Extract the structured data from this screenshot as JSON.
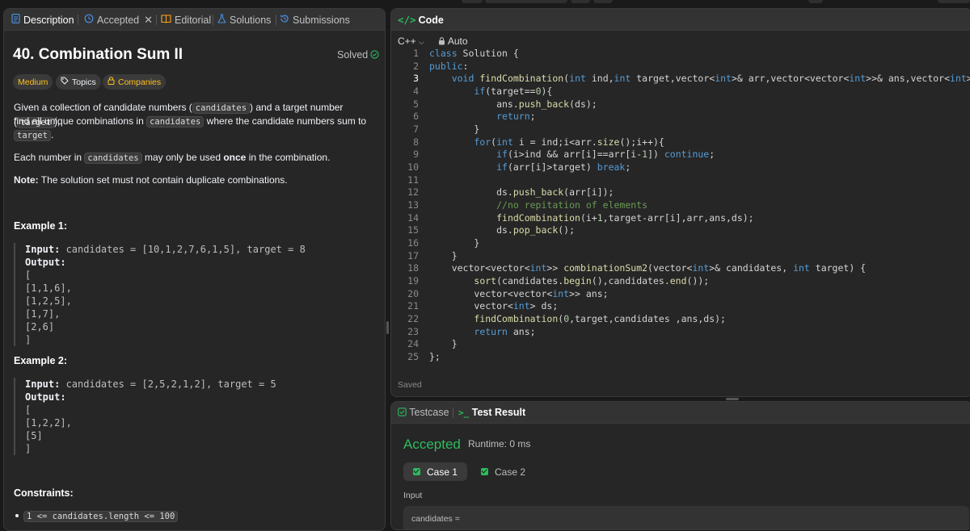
{
  "left_tabs": {
    "description": "Description",
    "accepted": "Accepted",
    "editorial": "Editorial",
    "solutions": "Solutions",
    "submissions": "Submissions"
  },
  "problem": {
    "title": "40. Combination Sum II",
    "status": "Solved",
    "tags": [
      "Medium",
      "Topics",
      "Companies"
    ],
    "desc1_a": "Given a collection of candidate numbers (",
    "desc1_code1": "candidates",
    "desc1_b": ") and a target number (",
    "desc1_code2": "target",
    "desc1_c": "),",
    "desc2_a": "find all unique combinations in ",
    "desc2_code": "candidates",
    "desc2_b": " where the candidate numbers sum to",
    "desc3_code": "target",
    "desc3_b": ".",
    "desc4_a": "Each number in ",
    "desc4_code": "candidates",
    "desc4_b": " may only be used ",
    "desc4_bold": "once",
    "desc4_c": " in the combination.",
    "note_label": "Note:",
    "note_text": " The solution set must not contain duplicate combinations.",
    "example1_title": "Example 1:",
    "example1_input_label": "Input:",
    "example1_input": " candidates = [10,1,2,7,6,1,5], target = 8",
    "example1_output_label": "Output:",
    "example1_output": [
      "[",
      "[1,1,6],",
      "[1,2,5],",
      "[1,7],",
      "[2,6]",
      "]"
    ],
    "example2_title": "Example 2:",
    "example2_input_label": "Input:",
    "example2_input": " candidates = [2,5,2,1,2], target = 5",
    "example2_output_label": "Output:",
    "example2_output": [
      "[",
      "[1,2,2],",
      "[5]",
      "]"
    ],
    "constraints_title": "Constraints:",
    "constraint1": "1 <= candidates.length <= 100"
  },
  "editor": {
    "title": "Code",
    "language": "C++",
    "mode": "Auto",
    "saved": "Saved",
    "current_line": 3
  },
  "results": {
    "tab_testcase": "Testcase",
    "tab_result": "Test Result",
    "verdict": "Accepted",
    "runtime": "Runtime: 0 ms",
    "case1": "Case 1",
    "case2": "Case 2",
    "input_label": "Input",
    "input_value": "candidates ="
  },
  "colors": {
    "accent_green": "#2cbb5d",
    "medium_yellow": "#ffc01e",
    "panel_bg": "#262626",
    "page_bg": "#1a1a1a"
  }
}
